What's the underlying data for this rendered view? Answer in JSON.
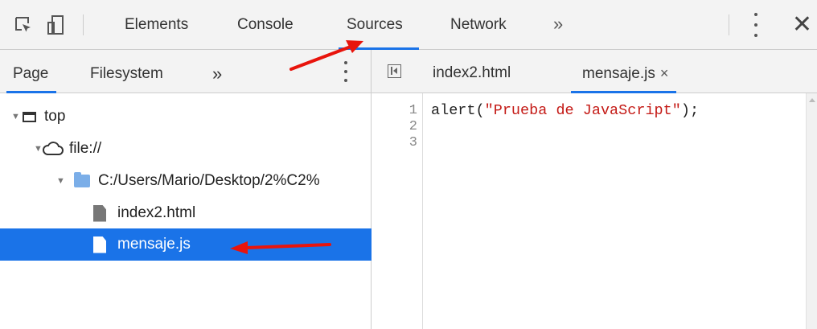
{
  "toolbar": {
    "tabs": [
      "Elements",
      "Console",
      "Sources",
      "Network"
    ],
    "active_tab": "Sources",
    "overflow": "»",
    "close": "✕"
  },
  "navigator": {
    "tabs": [
      "Page",
      "Filesystem"
    ],
    "active_tab": "Page",
    "overflow": "»",
    "tree": [
      {
        "label": "top",
        "type": "frame",
        "depth": 0,
        "expanded": true
      },
      {
        "label": "file://",
        "type": "cloud",
        "depth": 1,
        "expanded": true
      },
      {
        "label": "C:/Users/Mario/Desktop/2%C2%",
        "type": "folder",
        "depth": 2,
        "expanded": true
      },
      {
        "label": "index2.html",
        "type": "file",
        "depth": 3
      },
      {
        "label": "mensaje.js",
        "type": "file",
        "depth": 3,
        "selected": true
      }
    ]
  },
  "editor": {
    "tabs": [
      "index2.html",
      "mensaje.js"
    ],
    "active_tab": "mensaje.js",
    "close_glyph": "×",
    "line_numbers": [
      "1",
      "2",
      "3"
    ],
    "code": {
      "prefix": "alert(",
      "string": "\"Prueba de JavaScript\"",
      "suffix": ");"
    }
  },
  "colors": {
    "accent": "#1a73e8",
    "selection": "#1a73e8",
    "annotation_arrow": "#e8140c",
    "code_string": "#c41a16"
  }
}
